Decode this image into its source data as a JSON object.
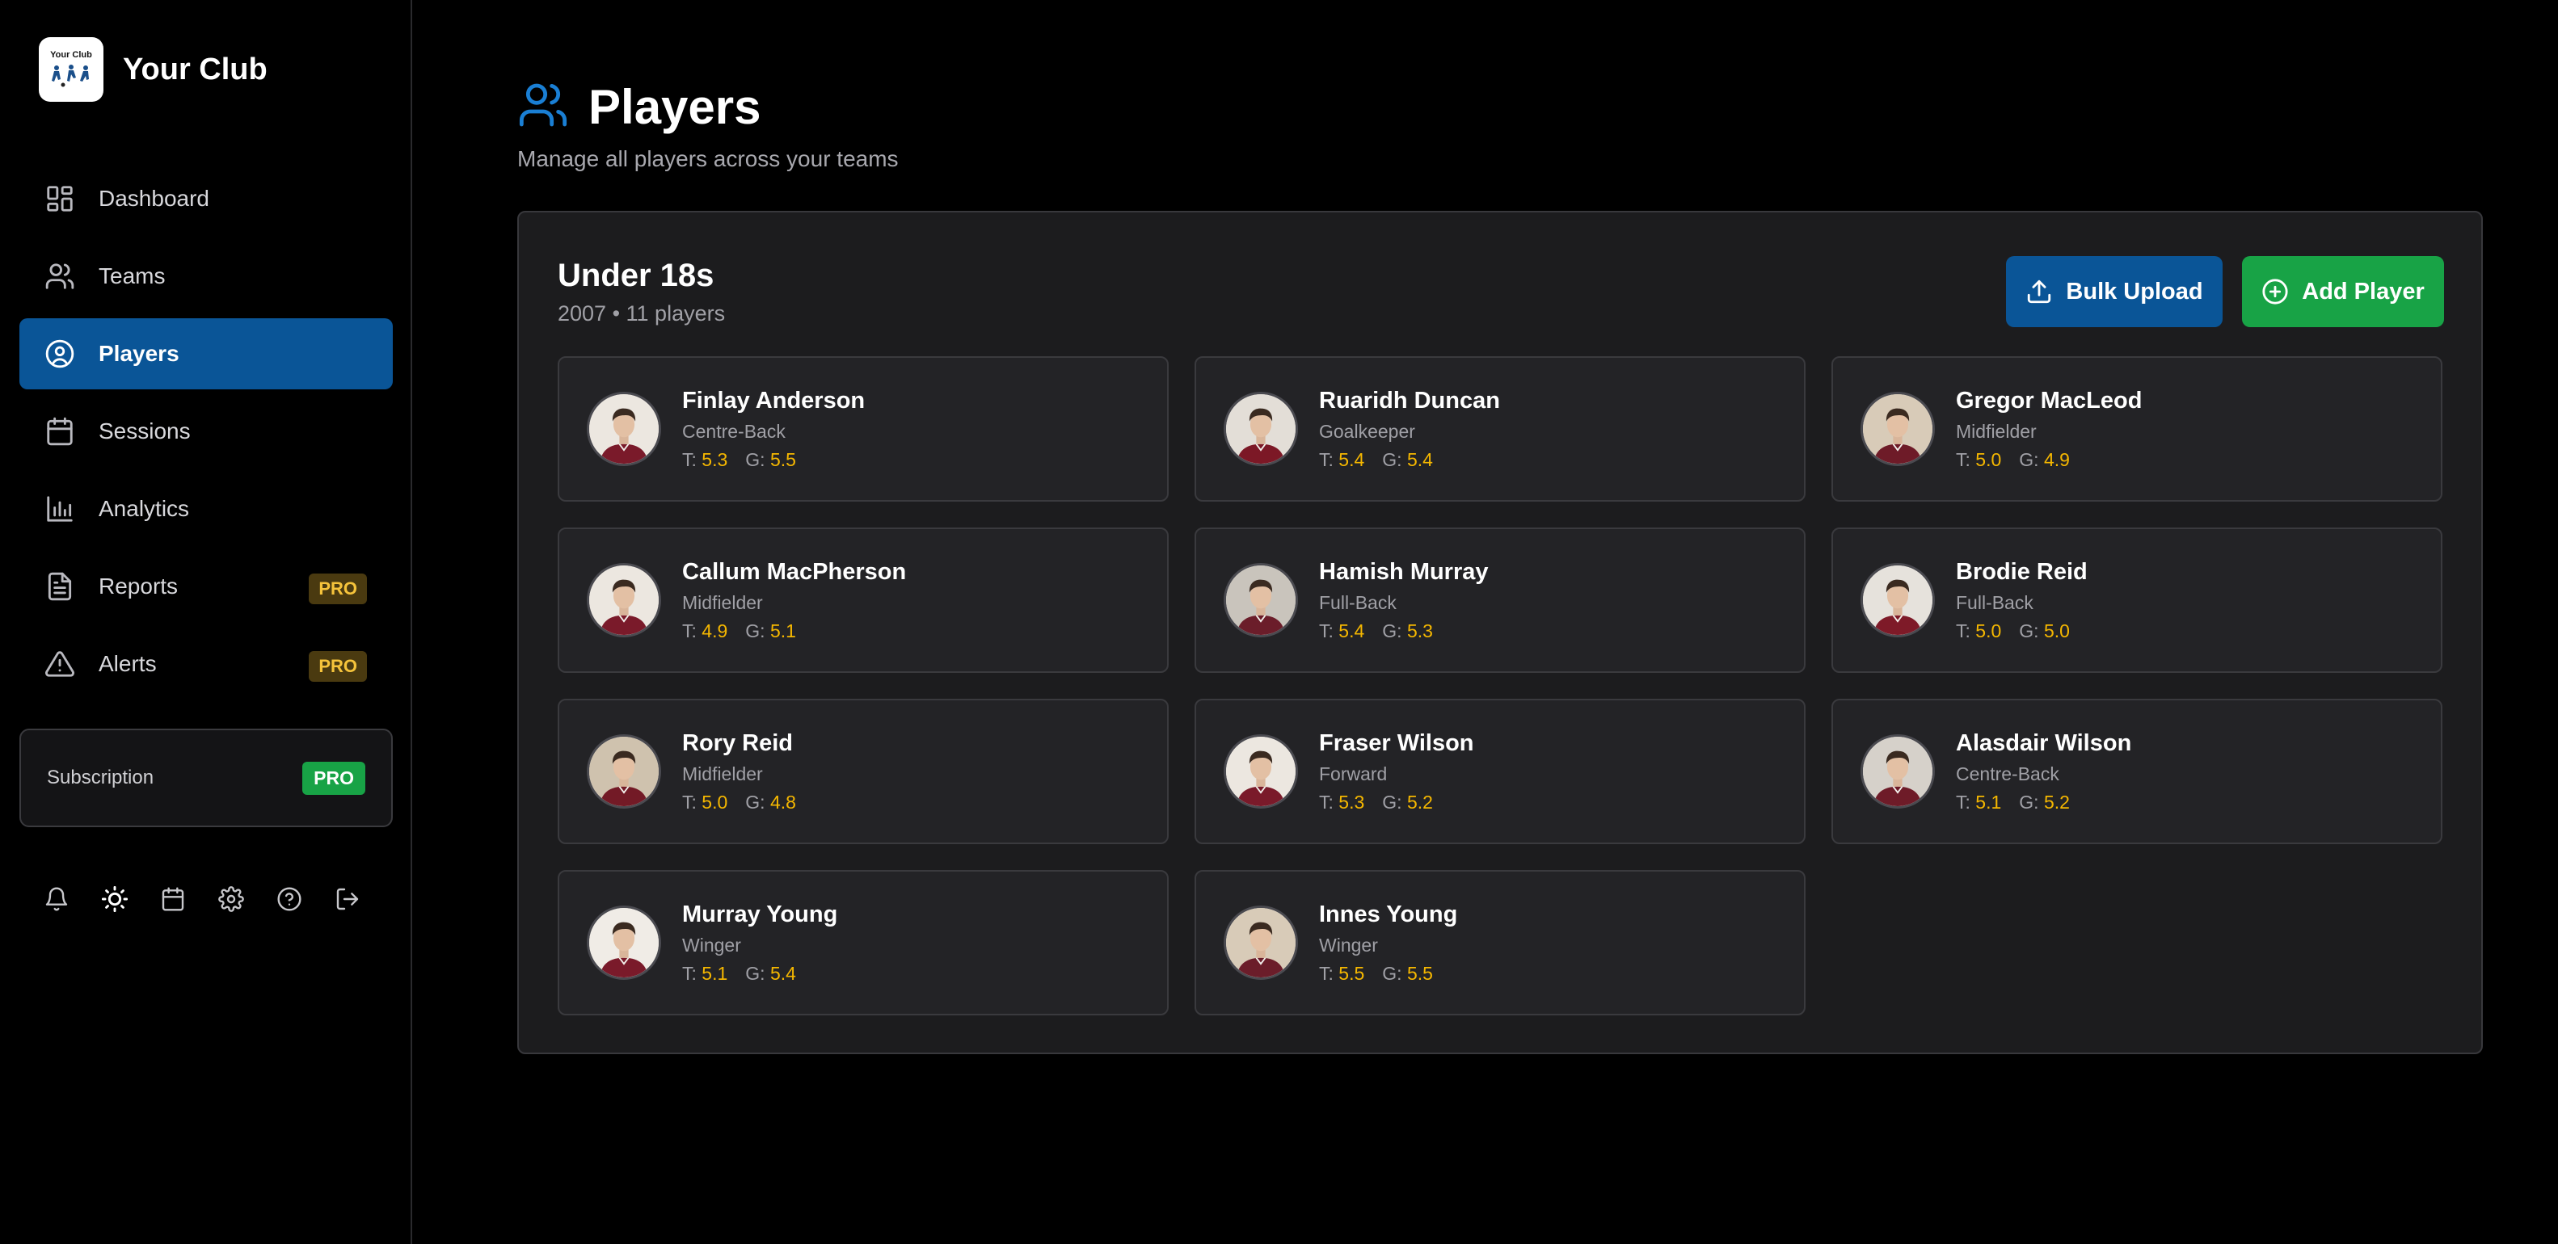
{
  "brand": {
    "name": "Your Club",
    "logo_text": "Your Club"
  },
  "sidebar": {
    "items": [
      {
        "label": "Dashboard",
        "icon": "dashboard-icon",
        "active": false
      },
      {
        "label": "Teams",
        "icon": "users-icon",
        "active": false
      },
      {
        "label": "Players",
        "icon": "user-circle-icon",
        "active": true
      },
      {
        "label": "Sessions",
        "icon": "calendar-icon",
        "active": false
      },
      {
        "label": "Analytics",
        "icon": "bar-chart-icon",
        "active": false
      },
      {
        "label": "Reports",
        "icon": "file-text-icon",
        "active": false,
        "badge": "PRO"
      },
      {
        "label": "Alerts",
        "icon": "alert-triangle-icon",
        "active": false,
        "badge": "PRO"
      }
    ],
    "subscription": {
      "label": "Subscription",
      "badge": "PRO"
    },
    "footer_icons": [
      "bell-icon",
      "sun-icon",
      "calendar-icon",
      "gear-icon",
      "help-icon",
      "logout-icon"
    ]
  },
  "header": {
    "title": "Players",
    "subtitle": "Manage all players across your teams"
  },
  "team": {
    "name": "Under 18s",
    "meta": "2007 • 11 players",
    "bulk_upload_label": "Bulk Upload",
    "add_player_label": "Add Player"
  },
  "stat_labels": {
    "t": "T:",
    "g": "G:"
  },
  "players": [
    {
      "name": "Finlay Anderson",
      "position": "Centre-Back",
      "t": "5.3",
      "g": "5.5"
    },
    {
      "name": "Ruaridh Duncan",
      "position": "Goalkeeper",
      "t": "5.4",
      "g": "5.4"
    },
    {
      "name": "Gregor MacLeod",
      "position": "Midfielder",
      "t": "5.0",
      "g": "4.9"
    },
    {
      "name": "Callum MacPherson",
      "position": "Midfielder",
      "t": "4.9",
      "g": "5.1"
    },
    {
      "name": "Hamish Murray",
      "position": "Full-Back",
      "t": "5.4",
      "g": "5.3"
    },
    {
      "name": "Brodie Reid",
      "position": "Full-Back",
      "t": "5.0",
      "g": "5.0"
    },
    {
      "name": "Rory Reid",
      "position": "Midfielder",
      "t": "5.0",
      "g": "4.8"
    },
    {
      "name": "Fraser Wilson",
      "position": "Forward",
      "t": "5.3",
      "g": "5.2"
    },
    {
      "name": "Alasdair Wilson",
      "position": "Centre-Back",
      "t": "5.1",
      "g": "5.2"
    },
    {
      "name": "Murray Young",
      "position": "Winger",
      "t": "5.1",
      "g": "5.4"
    },
    {
      "name": "Innes Young",
      "position": "Winger",
      "t": "5.5",
      "g": "5.5"
    }
  ],
  "colors": {
    "accent_blue": "#0a5597",
    "add_green": "#18a346",
    "stat_value": "#f5b700",
    "pro_badge": "#f5c33b"
  }
}
